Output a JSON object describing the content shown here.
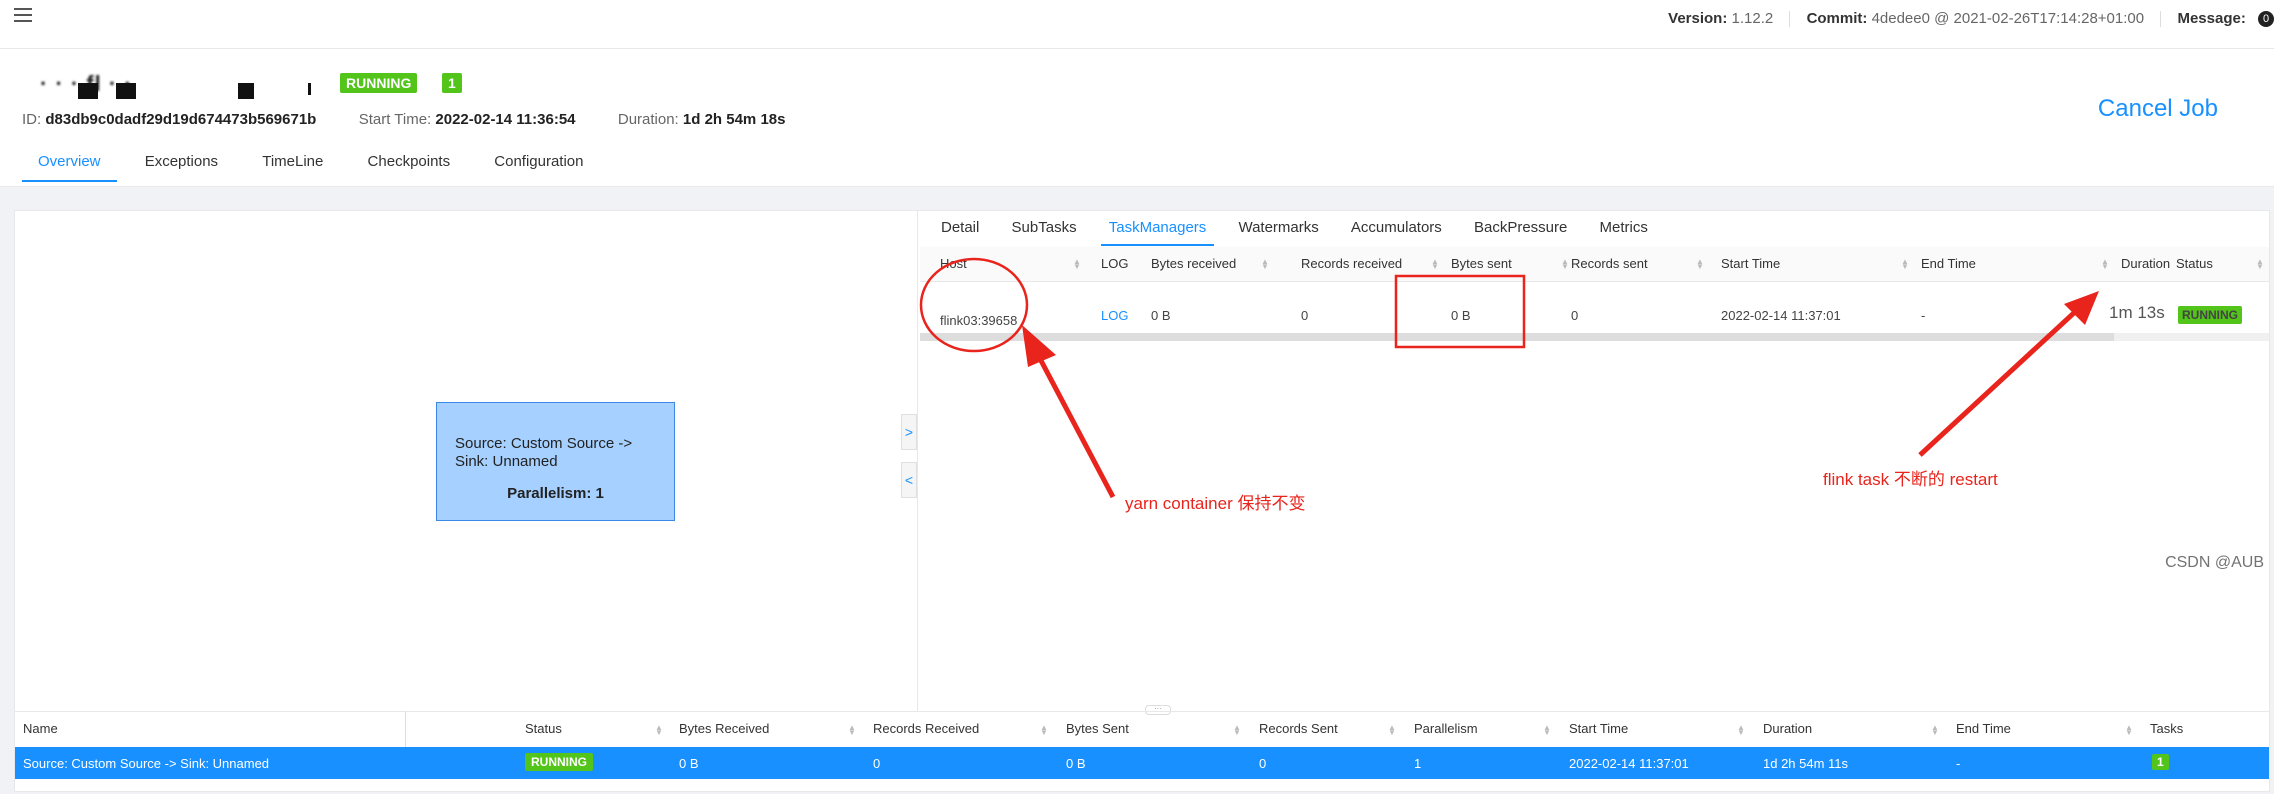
{
  "topbar": {
    "version_label": "Version:",
    "version_value": "1.12.2",
    "commit_label": "Commit:",
    "commit_value": "4dedee0 @ 2021-02-26T17:14:28+01:00",
    "message_label": "Message:",
    "message_badge": "0"
  },
  "job": {
    "name": "· · · fl · ·",
    "status": "RUNNING",
    "task_count": "1",
    "id_label": "ID:",
    "id_value": "d83db9c0dadf29d19d674473b569671b",
    "start_label": "Start Time:",
    "start_value": "2022-02-14 11:36:54",
    "duration_label": "Duration:",
    "duration_value": "1d 2h 54m 18s",
    "cancel_label": "Cancel Job"
  },
  "main_tabs": [
    "Overview",
    "Exceptions",
    "TimeLine",
    "Checkpoints",
    "Configuration"
  ],
  "main_tabs_active": 0,
  "node": {
    "title": "Source: Custom Source -> Sink: Unnamed",
    "parallelism": "Parallelism: 1"
  },
  "sub_tabs": [
    "Detail",
    "SubTasks",
    "TaskManagers",
    "Watermarks",
    "Accumulators",
    "BackPressure",
    "Metrics"
  ],
  "sub_tabs_active": 2,
  "taskmanagers": {
    "columns": [
      "Host",
      "LOG",
      "Bytes received",
      "Records received",
      "Bytes sent",
      "Records sent",
      "Start Time",
      "End Time",
      "Duration",
      "Status"
    ],
    "row": {
      "host": "flink03:39658",
      "log": "LOG",
      "bytes_received": "0 B",
      "records_received": "0",
      "bytes_sent": "0 B",
      "records_sent": "0",
      "start_time": "2022-02-14 11:37:01",
      "end_time": "-",
      "duration": "1m 13s",
      "status": "RUNNING"
    }
  },
  "annotations": {
    "left": "yarn container 保持不变",
    "right": "flink task 不断的 restart"
  },
  "vertices": {
    "columns": [
      "Name",
      "Status",
      "Bytes Received",
      "Records Received",
      "Bytes Sent",
      "Records Sent",
      "Parallelism",
      "Start Time",
      "Duration",
      "End Time",
      "Tasks"
    ],
    "row": {
      "name": "Source: Custom Source -> Sink: Unnamed",
      "status": "RUNNING",
      "bytes_received": "0 B",
      "records_received": "0",
      "bytes_sent": "0 B",
      "records_sent": "0",
      "parallelism": "1",
      "start_time": "2022-02-14 11:37:01",
      "duration": "1d 2h 54m 11s",
      "end_time": "-",
      "tasks": "1"
    }
  },
  "watermark": "CSDN @AUB",
  "colors": {
    "accent": "#1890ff",
    "running": "#52c41a",
    "annotation": "#e8241c",
    "node_fill": "#a6d0ff"
  }
}
